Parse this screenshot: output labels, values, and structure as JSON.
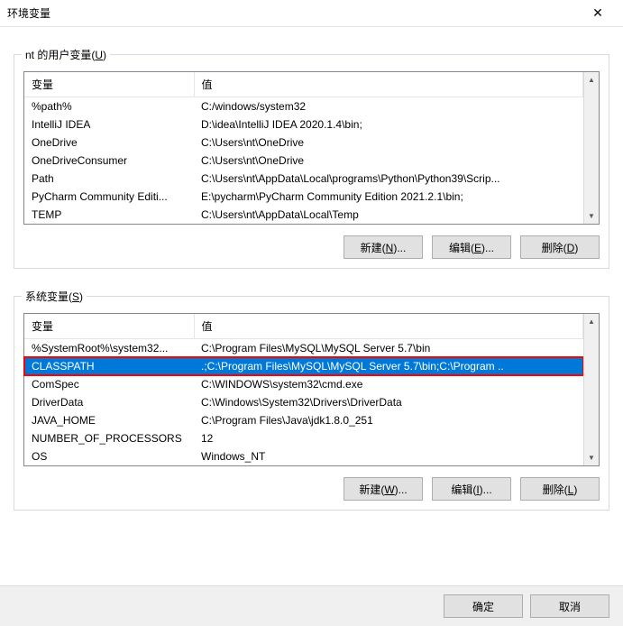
{
  "window": {
    "title": "环境变量"
  },
  "userVars": {
    "label_pre": "nt 的用户变量(",
    "label_key": "U",
    "label_post": ")",
    "headers": {
      "var": "变量",
      "val": "值"
    },
    "rows": [
      {
        "var": "%path%",
        "val": "C:/windows/system32"
      },
      {
        "var": "IntelliJ IDEA",
        "val": "D:\\idea\\IntelliJ IDEA 2020.1.4\\bin;"
      },
      {
        "var": "OneDrive",
        "val": "C:\\Users\\nt\\OneDrive"
      },
      {
        "var": "OneDriveConsumer",
        "val": "C:\\Users\\nt\\OneDrive"
      },
      {
        "var": "Path",
        "val": "C:\\Users\\nt\\AppData\\Local\\programs\\Python\\Python39\\Scrip..."
      },
      {
        "var": "PyCharm Community Editi...",
        "val": "E:\\pycharm\\PyCharm Community Edition 2021.2.1\\bin;"
      },
      {
        "var": "TEMP",
        "val": "C:\\Users\\nt\\AppData\\Local\\Temp"
      }
    ],
    "buttons": {
      "new_pre": "新建(",
      "new_key": "N",
      "new_post": ")...",
      "edit_pre": "编辑(",
      "edit_key": "E",
      "edit_post": ")...",
      "del_pre": "删除(",
      "del_key": "D",
      "del_post": ")"
    }
  },
  "sysVars": {
    "label_pre": "系统变量(",
    "label_key": "S",
    "label_post": ")",
    "headers": {
      "var": "变量",
      "val": "值"
    },
    "rows": [
      {
        "var": "%SystemRoot%\\system32...",
        "val": "C:\\Program Files\\MySQL\\MySQL Server 5.7\\bin",
        "selected": false
      },
      {
        "var": "CLASSPATH",
        "val": ".;C:\\Program Files\\MySQL\\MySQL Server 5.7\\bin;C:\\Program ..",
        "selected": true
      },
      {
        "var": "ComSpec",
        "val": "C:\\WINDOWS\\system32\\cmd.exe",
        "selected": false
      },
      {
        "var": "DriverData",
        "val": "C:\\Windows\\System32\\Drivers\\DriverData",
        "selected": false
      },
      {
        "var": "JAVA_HOME",
        "val": "C:\\Program Files\\Java\\jdk1.8.0_251",
        "selected": false
      },
      {
        "var": "NUMBER_OF_PROCESSORS",
        "val": "12",
        "selected": false
      },
      {
        "var": "OS",
        "val": "Windows_NT",
        "selected": false
      }
    ],
    "buttons": {
      "new_pre": "新建(",
      "new_key": "W",
      "new_post": ")...",
      "edit_pre": "编辑(",
      "edit_key": "I",
      "edit_post": ")...",
      "del_pre": "删除(",
      "del_key": "L",
      "del_post": ")"
    }
  },
  "footer": {
    "ok": "确定",
    "cancel": "取消"
  }
}
